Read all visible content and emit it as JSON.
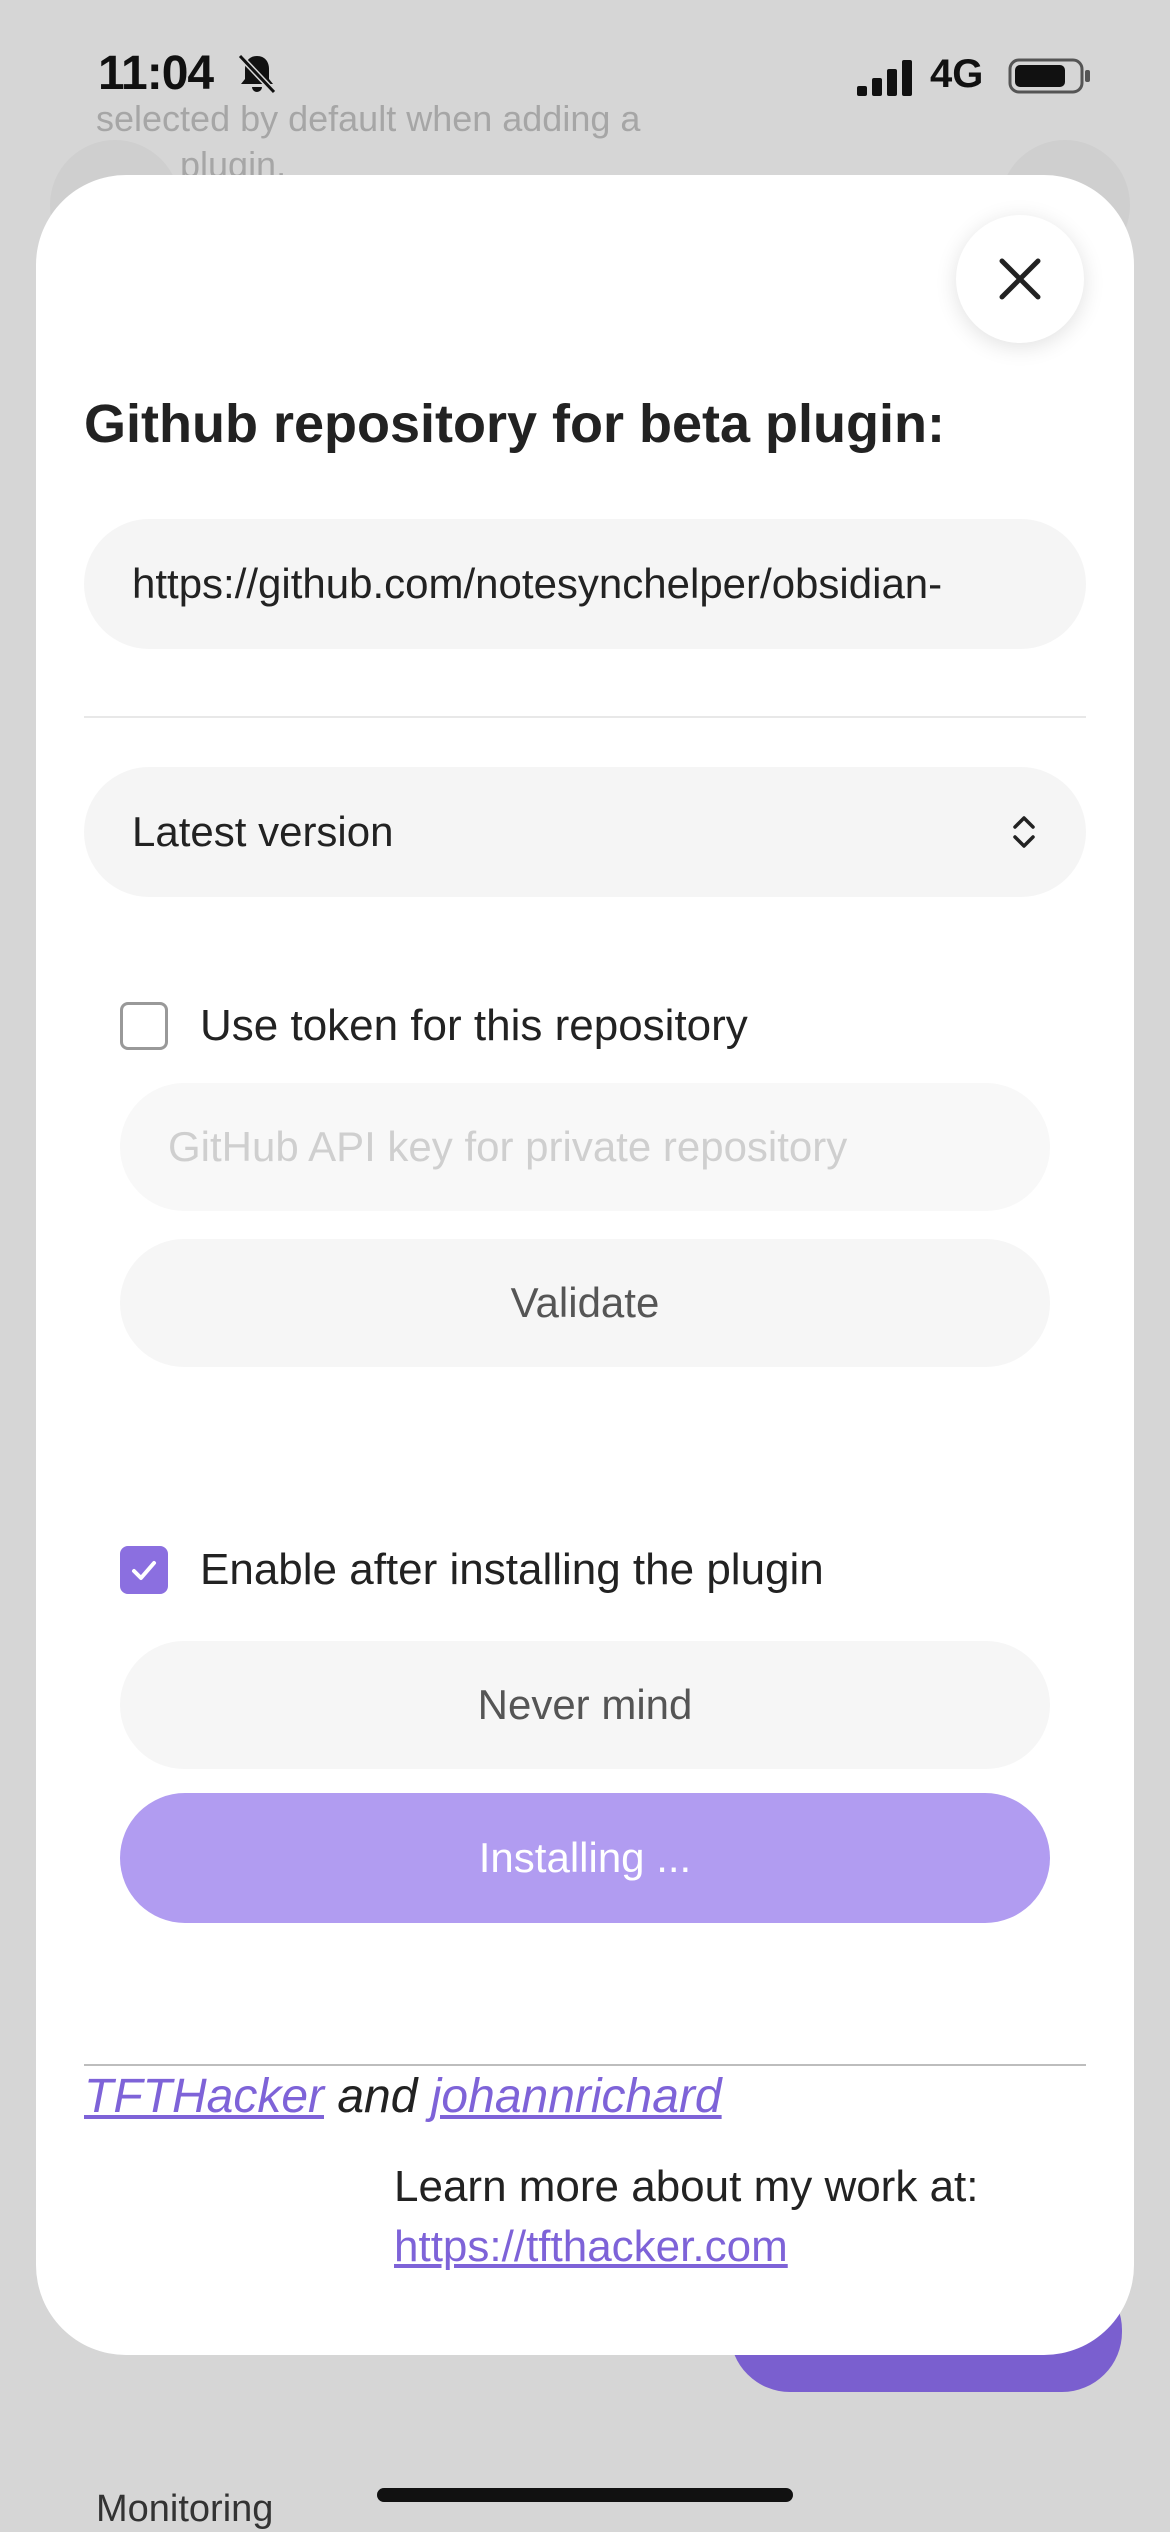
{
  "status_bar": {
    "time": "11:04",
    "network": "4G"
  },
  "background": {
    "line1": "selected by default when adding a",
    "line2": "plugin.",
    "bottom_label": "Monitoring",
    "accent_color": "#7a5fcf"
  },
  "modal": {
    "title": "Github repository for beta plugin:",
    "repo_value": "https://github.com/notesynchelper/obsidian-",
    "version_select": "Latest version",
    "token_checkbox_label": "Use token for this repository",
    "token_checked": false,
    "token_placeholder": "GitHub API key for private repository",
    "validate_label": "Validate",
    "enable_checkbox_label": "Enable after installing the plugin",
    "enable_checked": true,
    "never_mind_label": "Never mind",
    "install_label": "Installing ...",
    "credits": {
      "author1": "TFTHacker",
      "joiner": "and",
      "author2": "johannrichard"
    },
    "learn_more_text": "Learn more about my work at:",
    "learn_more_link": "https://tfthacker.com",
    "accent_color": "#8b6fe0"
  }
}
